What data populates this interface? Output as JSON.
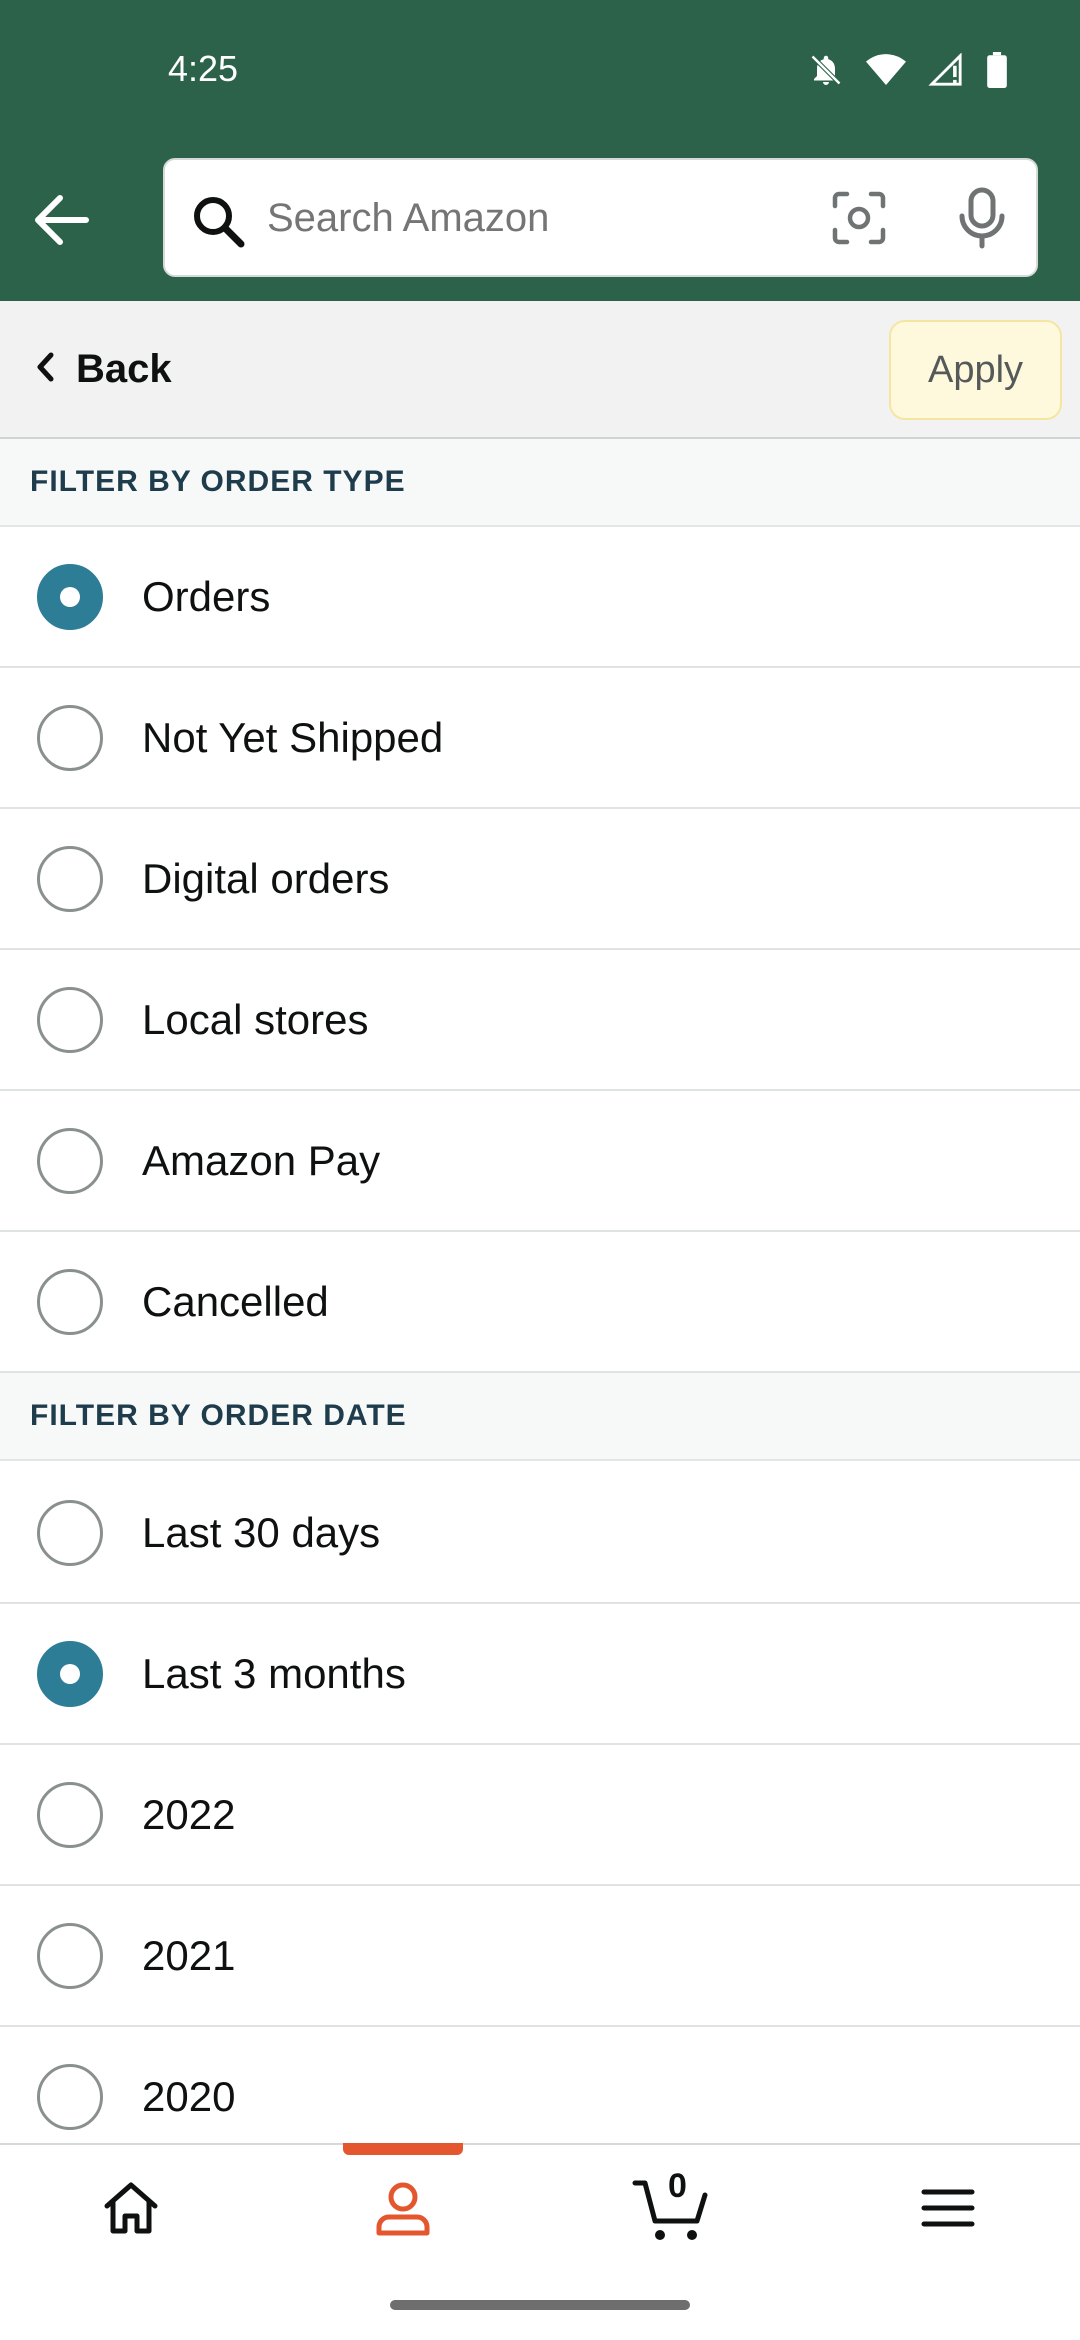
{
  "status_bar": {
    "time": "4:25",
    "icons": [
      "notifications-off-icon",
      "wifi-icon",
      "signal-icon",
      "battery-icon"
    ]
  },
  "header": {
    "search_placeholder": "Search Amazon",
    "icons": [
      "back-arrow-icon",
      "search-icon",
      "camera-icon",
      "microphone-icon"
    ],
    "bg_color": "#2b6249"
  },
  "subbar": {
    "back_label": "Back",
    "apply_label": "Apply"
  },
  "order_type": {
    "title": "FILTER BY ORDER TYPE",
    "options": [
      {
        "label": "Orders",
        "selected": true
      },
      {
        "label": "Not Yet Shipped",
        "selected": false
      },
      {
        "label": "Digital orders",
        "selected": false
      },
      {
        "label": "Local stores",
        "selected": false
      },
      {
        "label": "Amazon Pay",
        "selected": false
      },
      {
        "label": "Cancelled",
        "selected": false
      }
    ]
  },
  "order_date": {
    "title": "FILTER BY ORDER DATE",
    "options": [
      {
        "label": "Last 30 days",
        "selected": false
      },
      {
        "label": "Last 3 months",
        "selected": true
      },
      {
        "label": "2022",
        "selected": false
      },
      {
        "label": "2021",
        "selected": false
      },
      {
        "label": "2020",
        "selected": false
      }
    ]
  },
  "bottom_nav": {
    "items": [
      "home-icon",
      "account-icon",
      "cart-icon",
      "menu-icon"
    ],
    "active": "account-icon",
    "cart_count": "0",
    "accent_color": "#e4572e"
  },
  "colors": {
    "radio_selected": "#2e7d96",
    "apply_bg": "#fef9dd"
  }
}
